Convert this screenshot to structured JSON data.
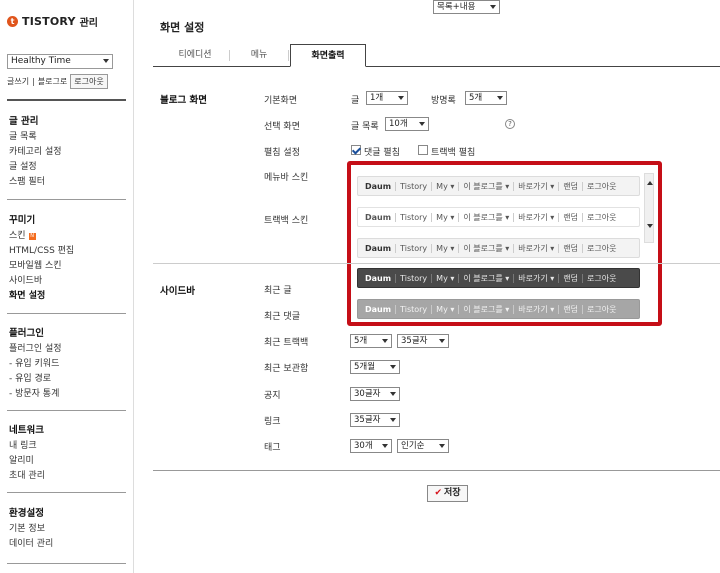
{
  "sidebar": {
    "logo": {
      "brand": "TISTORY",
      "sub": "관리"
    },
    "blog_select": "Healthy Time",
    "links": {
      "write": "글쓰기",
      "blog": "블로그로",
      "logout": "로그아웃"
    },
    "groups": [
      {
        "title": "글 관리",
        "items": [
          "글 목록",
          "카테고리 설정",
          "글 설정",
          "스팸 필터"
        ]
      },
      {
        "title": "꾸미기",
        "items": [
          "스킨",
          "HTML/CSS 편집",
          "모바일웹 스킨",
          "사이드바",
          "화면 설정"
        ]
      },
      {
        "title": "플러그인",
        "items": [
          "플러그인 설정",
          "- 유입 키워드",
          "- 유입 경로",
          "- 방문자 통계"
        ]
      },
      {
        "title": "네트워크",
        "items": [
          "내 링크",
          "알리미",
          "초대 관리"
        ]
      },
      {
        "title": "환경설정",
        "items": [
          "기본 정보",
          "데이터 관리"
        ]
      }
    ],
    "new_badge": "N"
  },
  "header": {
    "title": "화면 설정"
  },
  "tabs": [
    {
      "label": "티에디션"
    },
    {
      "label": "메뉴"
    },
    {
      "label": "화면출력"
    }
  ],
  "blog_screen": {
    "section": "블로그 화면",
    "default_screen": {
      "label": "기본화면",
      "posts_label": "글",
      "posts_value": "1개",
      "guestbook_label": "방명록",
      "guestbook_value": "5개"
    },
    "selected_screen": {
      "label": "선택 화면",
      "list_label": "글 목록",
      "list_value": "10개",
      "list_mode": "목록+내용",
      "help": "?"
    },
    "fold": {
      "label": "펼침 설정",
      "comment_label": "댓글 펼침",
      "comment_checked": true,
      "trackback_label": "트랙백 펼침",
      "trackback_checked": false
    },
    "menubar_skin_label": "메뉴바 스킨",
    "trackback_skin_label": "트랙백 스킨",
    "skin_items": [
      "Daum",
      "Tistory",
      "My",
      "이 블로그를",
      "바로가기",
      "랜덤",
      "로그아웃"
    ],
    "skin_item_arrow": "▾"
  },
  "sidebar_settings": {
    "section": "사이드바",
    "rows": [
      {
        "label": "최근 글"
      },
      {
        "label": "최근 댓글"
      },
      {
        "label": "최근 트랙백",
        "values": [
          "5개",
          "35글자"
        ]
      },
      {
        "label": "최근 보관함",
        "values": [
          "5개월"
        ]
      },
      {
        "label": "공지",
        "values": [
          "30글자"
        ]
      },
      {
        "label": "링크",
        "values": [
          "35글자"
        ]
      },
      {
        "label": "태그",
        "values": [
          "30개",
          "인기순"
        ]
      }
    ]
  },
  "save_button": {
    "icon": "✔",
    "label": "저장"
  }
}
